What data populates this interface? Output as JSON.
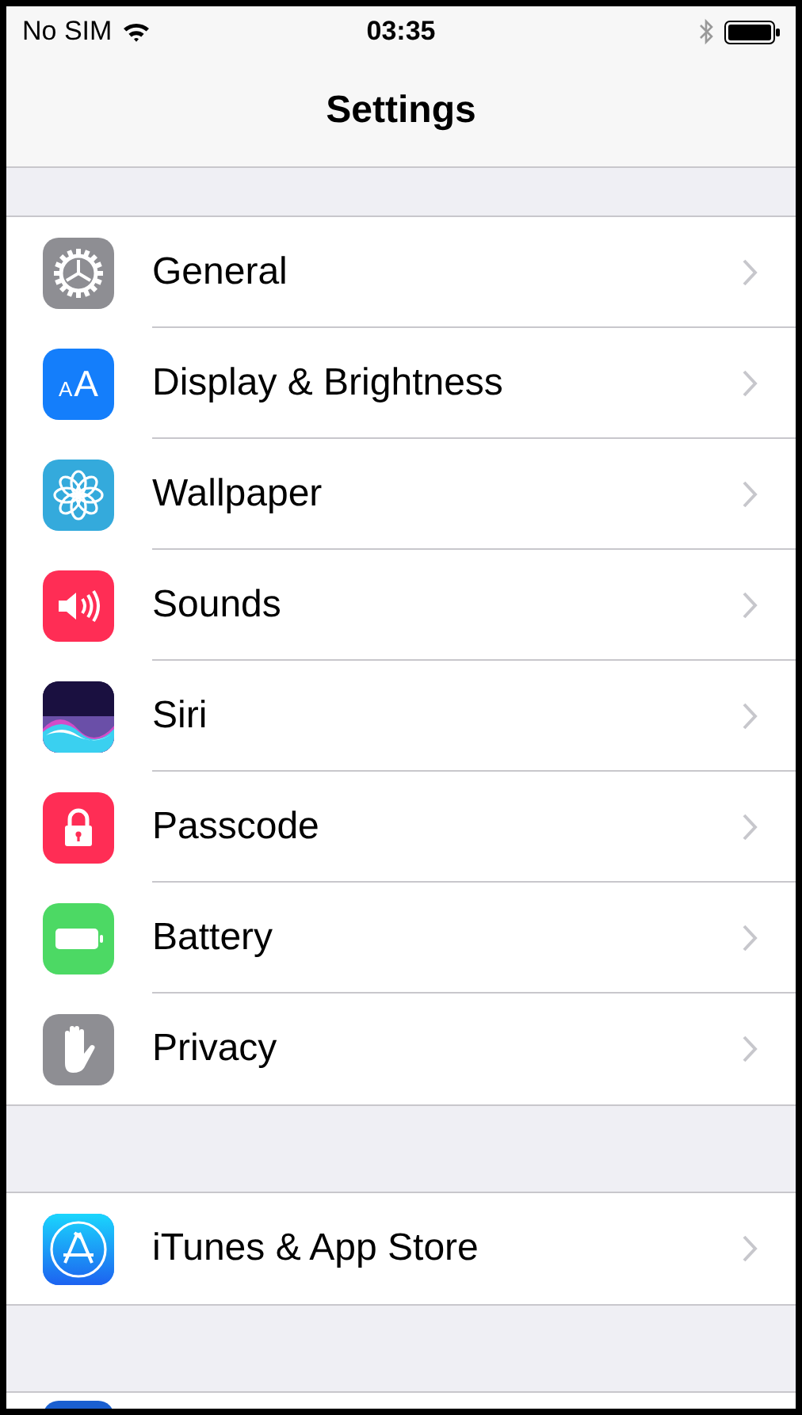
{
  "status_bar": {
    "carrier": "No SIM",
    "time": "03:35"
  },
  "nav": {
    "title": "Settings"
  },
  "groups": [
    {
      "rows": [
        {
          "kind": "gear",
          "label": "General"
        },
        {
          "kind": "display",
          "icon_letters": [
            "A",
            "A"
          ],
          "label": "Display & Brightness"
        },
        {
          "kind": "flower",
          "label": "Wallpaper"
        },
        {
          "kind": "speaker",
          "label": "Sounds"
        },
        {
          "kind": "siri",
          "label": "Siri"
        },
        {
          "kind": "lock",
          "label": "Passcode"
        },
        {
          "kind": "battery",
          "label": "Battery"
        },
        {
          "kind": "hand",
          "label": "Privacy"
        }
      ]
    },
    {
      "rows": [
        {
          "kind": "appstore",
          "label": "iTunes & App Store"
        }
      ]
    },
    {
      "rows": [
        {
          "kind": "tile"
        }
      ]
    }
  ]
}
